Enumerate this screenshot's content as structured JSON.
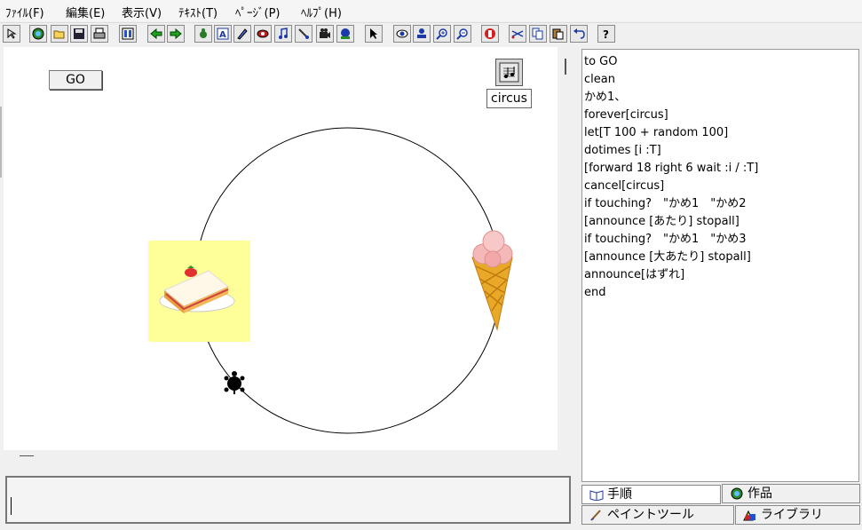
{
  "menu": [
    "ﾌｧｲﾙ(F)",
    "編集(E)",
    "表示(V)",
    "ﾃｷｽﾄ(T)",
    "ﾍﾟｰｼﾞ(P)",
    "ﾍﾙﾌﾟ(H)"
  ],
  "toolbar": {
    "icons": [
      "pointer-small-icon",
      "globe-icon",
      "open-folder-icon",
      "save-disk-icon",
      "print-icon",
      "page-layout-icon",
      "back-arrow-icon",
      "forward-arrow-icon",
      "turtle-icon",
      "text-box-icon",
      "pen-icon",
      "eye-shape-icon",
      "music-note-icon",
      "brush-icon",
      "video-camera-icon",
      "record-icon",
      "select-arrow-icon",
      "look-eye-icon",
      "stamp-icon",
      "zoom-in-icon",
      "zoom-out-icon",
      "stop-hand-icon",
      "cut-icon",
      "copy-icon",
      "paste-icon",
      "undo-icon",
      "help-icon"
    ],
    "help_label": "?"
  },
  "canvas": {
    "go_button": "GO",
    "music_label": "circus"
  },
  "code": [
    "to GO",
    "clean",
    "かめ1、",
    "forever[circus]",
    "let[T 100 + random 100]",
    "dotimes [i :T]",
    "[forward 18 right 6 wait :i / :T]",
    "cancel[circus]",
    "if touching?　\"かめ1　\"かめ2",
    "[announce [あたり] stopall]",
    "if touching?　\"かめ1　\"かめ3",
    "[announce [大あたり] stopall]",
    "announce[はずれ]",
    "end"
  ],
  "tabs": {
    "procedures": "手順",
    "works": "作品",
    "paint_tool": "ペイントツール",
    "library": "ライブラリ"
  },
  "colors": {
    "cake_background": "#ffff99",
    "canvas": "#ffffff"
  }
}
